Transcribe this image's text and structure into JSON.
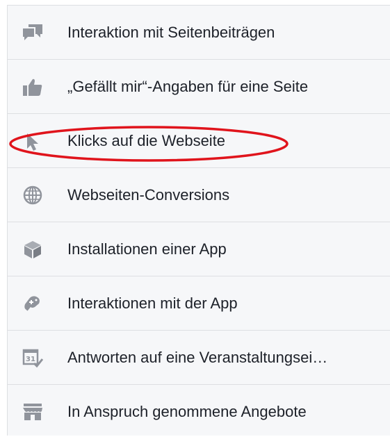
{
  "objectives": {
    "items": [
      {
        "label": "Interaktion mit Seitenbeiträgen",
        "icon": "speech-bubbles-icon"
      },
      {
        "label": "„Gefällt mir“-Angaben für eine Seite",
        "icon": "thumbs-up-icon"
      },
      {
        "label": "Klicks auf die Webseite",
        "icon": "cursor-pointer-icon"
      },
      {
        "label": "Webseiten-Conversions",
        "icon": "globe-icon"
      },
      {
        "label": "Installationen einer App",
        "icon": "app-box-icon"
      },
      {
        "label": "Interaktionen mit der App",
        "icon": "gamepad-icon"
      },
      {
        "label": "Antworten auf eine Veranstaltungsei…",
        "icon": "calendar-check-icon"
      },
      {
        "label": "In Anspruch genommene Angebote",
        "icon": "storefront-icon"
      }
    ],
    "highlighted_item": "Klicks auf die Webseite"
  },
  "colors": {
    "panel_bg": "#f6f7f9",
    "divider": "#dddfe2",
    "text": "#1d2129",
    "icon": "#90949c",
    "annotation": "#e0141c"
  }
}
